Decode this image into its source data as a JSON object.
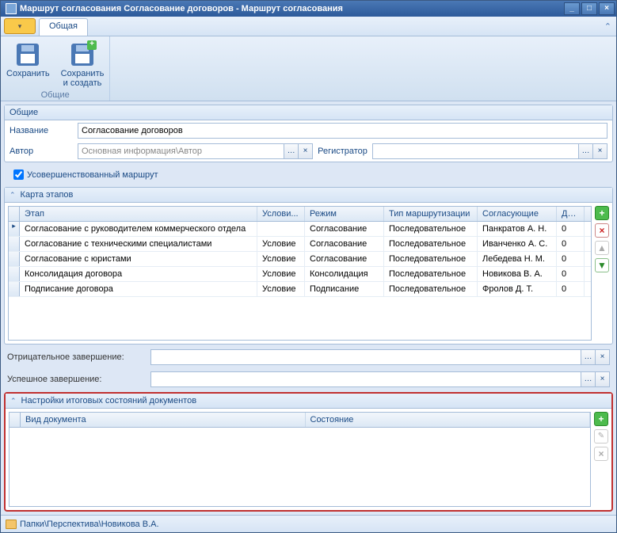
{
  "window": {
    "title": "Маршрут согласования Согласование договоров - Маршрут согласования"
  },
  "tabs": {
    "main": "Общая"
  },
  "ribbon": {
    "save": "Сохранить",
    "save_create": "Сохранить\nи создать",
    "group": "Общие"
  },
  "general": {
    "header": "Общие",
    "name_label": "Название",
    "name_value": "Согласование договоров",
    "author_label": "Автор",
    "author_value": "Основная информация\\Автор",
    "registrar_label": "Регистратор",
    "registrar_value": ""
  },
  "advanced_checkbox": "Усовершенствованный маршрут",
  "stages": {
    "header": "Карта этапов",
    "columns": {
      "stage": "Этап",
      "condition": "Услови...",
      "mode": "Режим",
      "routing": "Тип маршрутизации",
      "approvers": "Согласующие",
      "duration": "Дли..."
    },
    "rows": [
      {
        "stage": "Согласование с руководителем коммерческого отдела",
        "condition": "",
        "mode": "Согласование",
        "routing": "Последовательное",
        "approvers": "Панкратов А. Н.",
        "duration": "0"
      },
      {
        "stage": "Согласование с техническими специалистами",
        "condition": "Условие",
        "mode": "Согласование",
        "routing": "Последовательное",
        "approvers": "Иванченко А. С.",
        "duration": "0"
      },
      {
        "stage": "Согласование с юристами",
        "condition": "Условие",
        "mode": "Согласование",
        "routing": "Последовательное",
        "approvers": "Лебедева Н. М.",
        "duration": "0"
      },
      {
        "stage": "Консолидация договора",
        "condition": "Условие",
        "mode": "Консолидация",
        "routing": "Последовательное",
        "approvers": "Новикова В. А.",
        "duration": "0"
      },
      {
        "stage": "Подписание договора",
        "condition": "Условие",
        "mode": "Подписание",
        "routing": "Последовательное",
        "approvers": "Фролов Д. Т.",
        "duration": "0"
      }
    ]
  },
  "completion": {
    "negative_label": "Отрицательное завершение:",
    "negative_value": "",
    "success_label": "Успешное завершение:",
    "success_value": ""
  },
  "final_states": {
    "header": "Настройки итоговых состояний документов",
    "columns": {
      "doctype": "Вид документа",
      "state": "Состояние"
    }
  },
  "footer": {
    "path": "Папки\\Перспектива\\Новикова В.А."
  }
}
